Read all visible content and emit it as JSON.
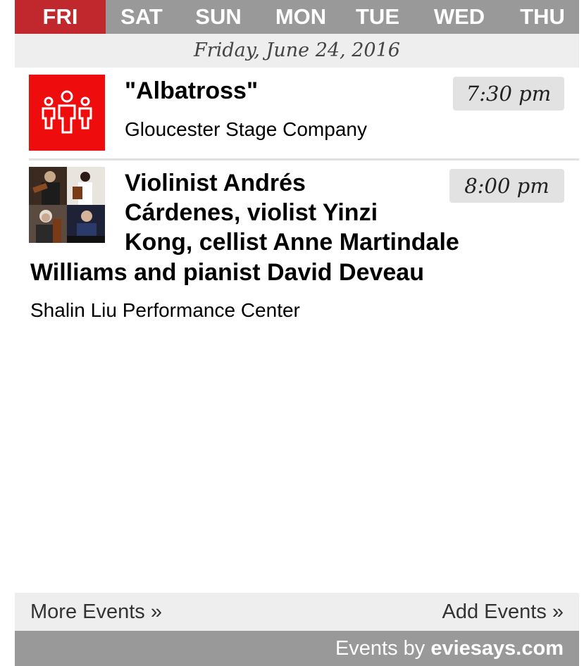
{
  "tabs": [
    {
      "label": "FRI",
      "active": true
    },
    {
      "label": "SAT",
      "active": false
    },
    {
      "label": "SUN",
      "active": false
    },
    {
      "label": "MON",
      "active": false
    },
    {
      "label": "TUE",
      "active": false
    },
    {
      "label": "WED",
      "active": false
    },
    {
      "label": "THU",
      "active": false
    }
  ],
  "date_heading": "Friday, June 24, 2016",
  "events": [
    {
      "title": "\"Albatross\"",
      "time": "7:30 pm",
      "venue": "Gloucester Stage Company",
      "thumbnail": "people-icon"
    },
    {
      "title_line1": "Violinist Andrés",
      "title_line2": "Cárdenes, violist Yinzi",
      "title_line3": "Kong, cellist Anne Martindale",
      "title_line4": "Williams and pianist David Deveau",
      "time": "8:00 pm",
      "venue": "Shalin Liu Performance Center",
      "thumbnail": "musicians-photo"
    }
  ],
  "footer": {
    "more_events": "More Events »",
    "add_events": "Add Events »",
    "credit_prefix": "Events by ",
    "credit_brand": "eviesays.com"
  },
  "colors": {
    "active_tab": "#c0282d",
    "tab_bar": "#999999",
    "date_bar": "#eeeeee",
    "thumb_red": "#ef0c0c",
    "time_badge": "#e2e2e2"
  }
}
